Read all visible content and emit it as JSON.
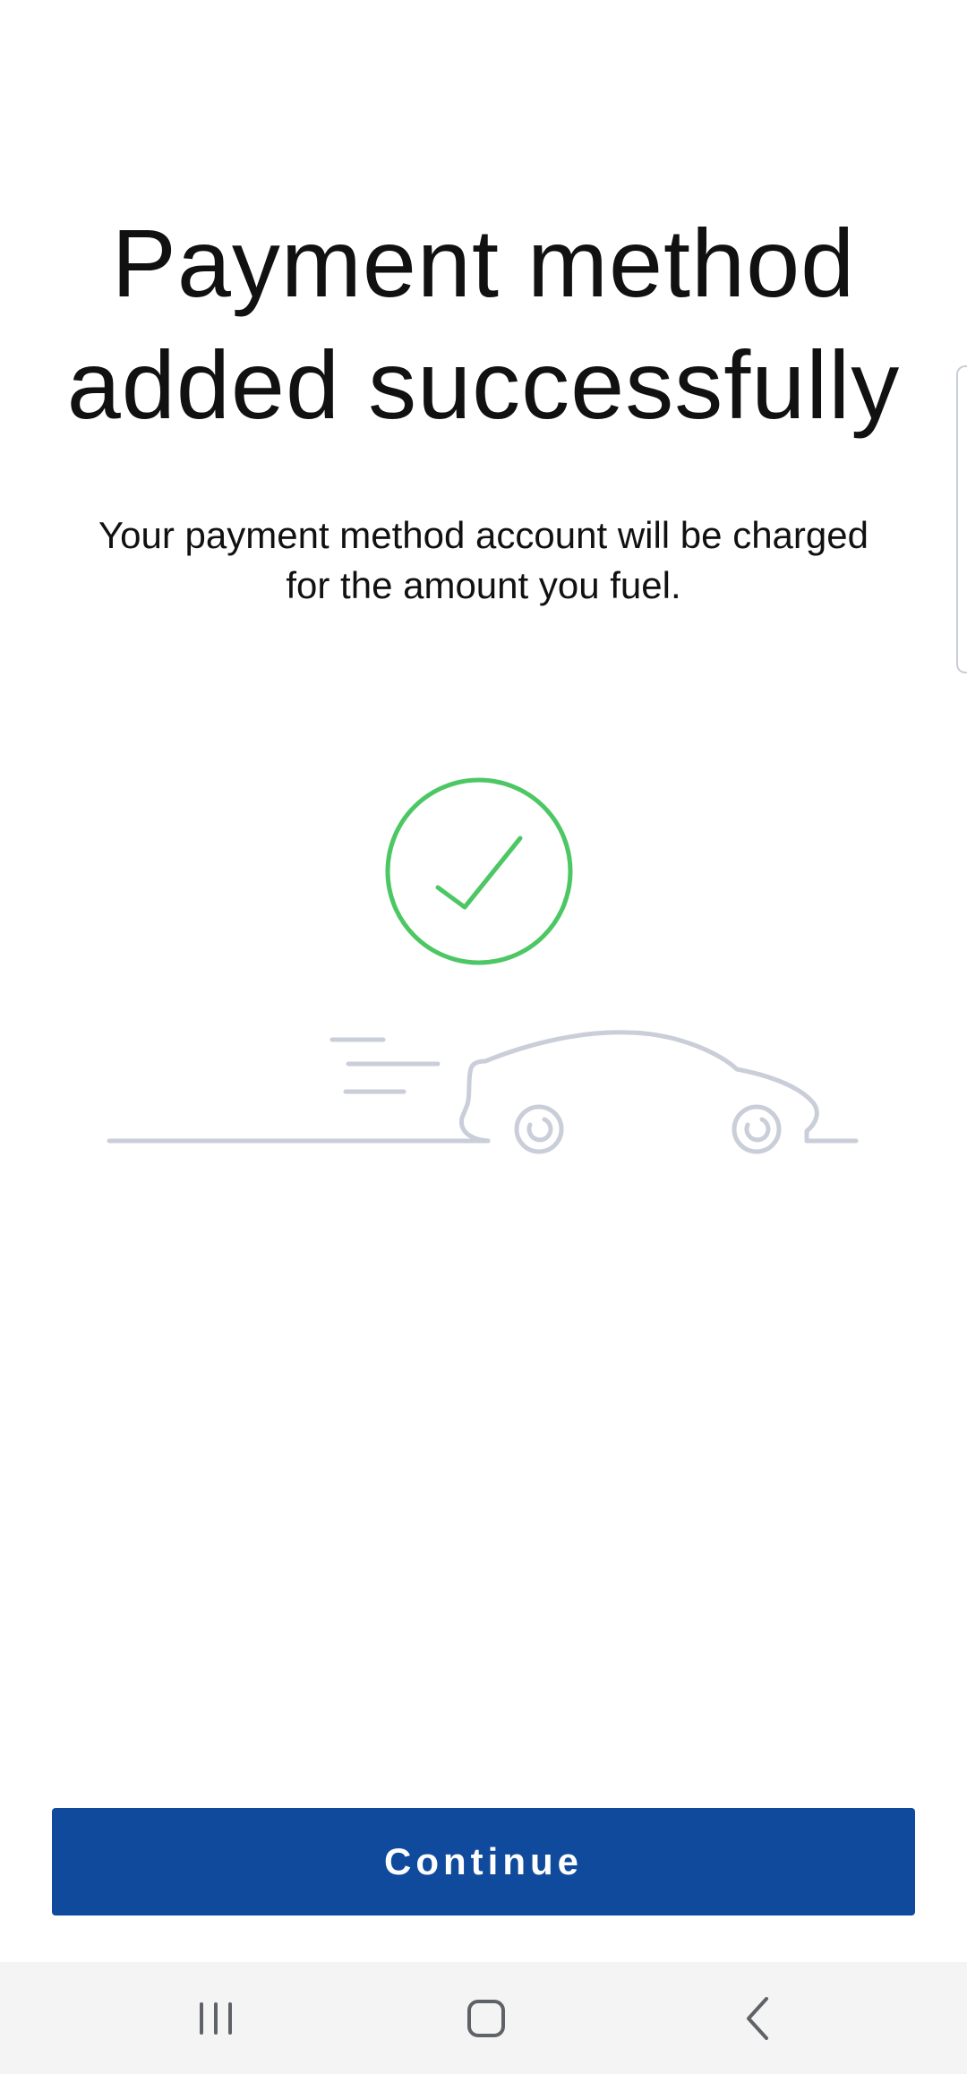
{
  "header": {
    "title_line1": "Payment method",
    "title_line2": "added successfully"
  },
  "message": {
    "line1": "Your payment method account will be charged",
    "line2": "for the amount you fuel."
  },
  "illustration": {
    "success_icon": "checkmark-circle-icon",
    "car_icon": "car-speed-lines-icon",
    "success_color": "#4cc764",
    "car_color": "#c9ced8"
  },
  "actions": {
    "continue_label": "Continue",
    "button_color": "#0f4a9c"
  },
  "navigation": {
    "recents_icon": "recents-icon",
    "home_icon": "home-icon",
    "back_icon": "back-icon"
  }
}
